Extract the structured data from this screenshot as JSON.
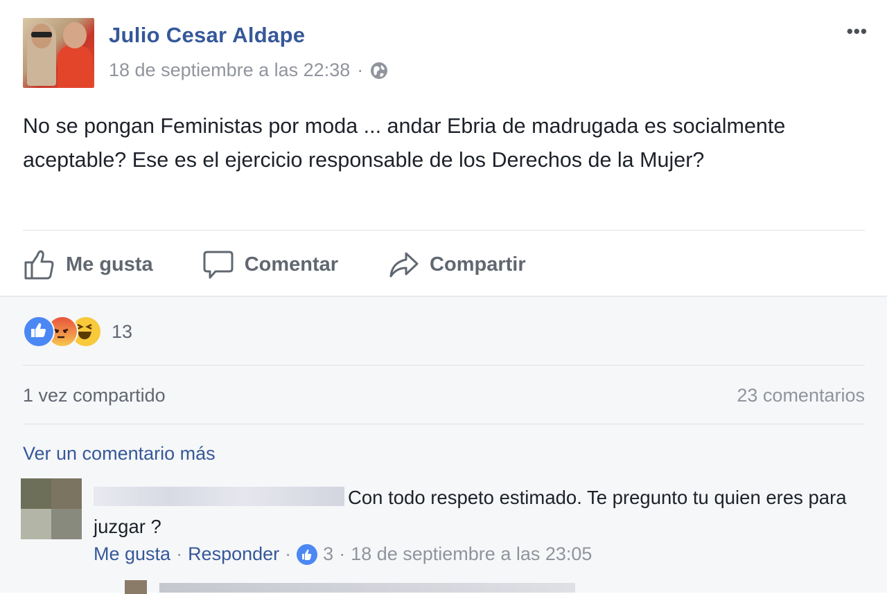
{
  "post": {
    "author": "Julio Cesar Aldape",
    "timestamp": "18 de septiembre a las 22:38",
    "separator": "·",
    "privacy_icon": "globe-icon",
    "more_icon": "•••",
    "text": "No se pongan Feministas por moda ... andar Ebria de madrugada es socialmente aceptable? Ese es el ejercicio responsable de los Derechos de la Mujer?"
  },
  "actions": {
    "like": "Me gusta",
    "comment": "Comentar",
    "share": "Compartir"
  },
  "reactions": {
    "types": [
      "like",
      "angry",
      "haha"
    ],
    "count": "13"
  },
  "stats": {
    "shares": "1 vez compartido",
    "comments": "23 comentarios"
  },
  "comments": {
    "view_more": "Ver un comentario más",
    "items": [
      {
        "text": "Con todo respeto estimado. Te pregunto tu quien eres para juzgar ?",
        "like_label": "Me gusta",
        "reply_label": "Responder",
        "like_count": "3",
        "timestamp": "18 de septiembre a las 23:05"
      }
    ]
  },
  "colors": {
    "link": "#365899",
    "muted": "#90949c",
    "like_blue": "#4b88f4",
    "background_grey": "#f6f7f9"
  }
}
